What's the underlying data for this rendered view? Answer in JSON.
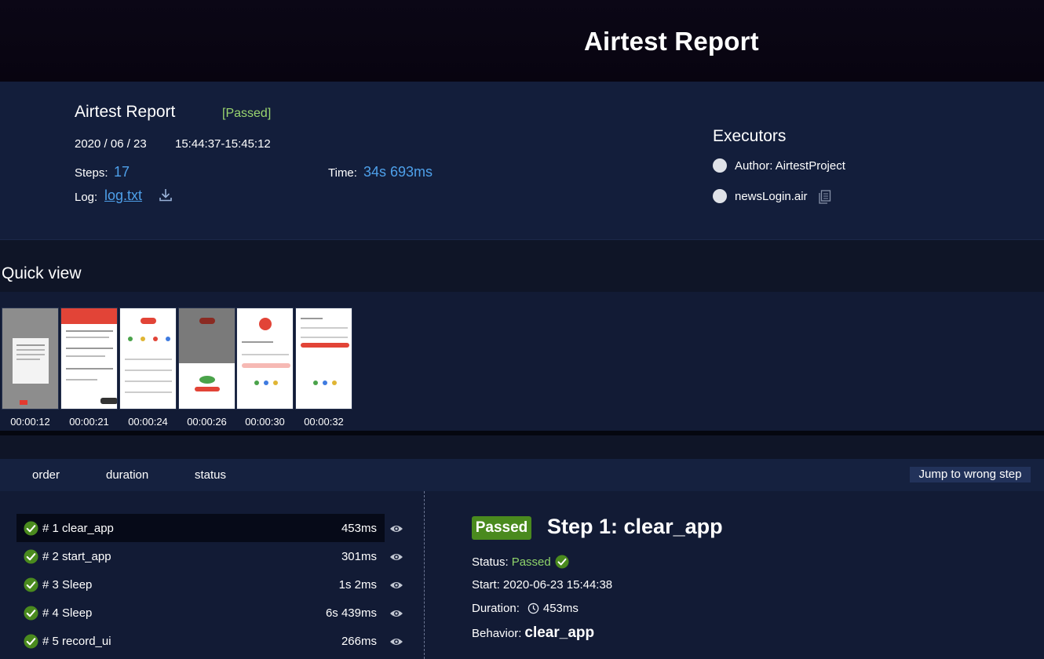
{
  "header": {
    "title": "Airtest Report"
  },
  "summary": {
    "title": "Airtest Report",
    "status": "[Passed]",
    "date": "2020 / 06 / 23",
    "time_range": "15:44:37-15:45:12",
    "steps_label": "Steps:",
    "steps_value": "17",
    "time_label": "Time:",
    "time_value": "34s 693ms",
    "log_label": "Log:",
    "log_link": "log.txt",
    "icons": {
      "status": "check-circle-icon",
      "download": "download-icon"
    }
  },
  "executors": {
    "title": "Executors",
    "items": [
      {
        "label": "Author: AirtestProject"
      },
      {
        "label": "newsLogin.air"
      }
    ],
    "copy_icon": "copy-icon"
  },
  "quick_view": {
    "title": "Quick view",
    "thumbnails": [
      {
        "time": "00:00:12"
      },
      {
        "time": "00:00:21"
      },
      {
        "time": "00:00:24"
      },
      {
        "time": "00:00:26"
      },
      {
        "time": "00:00:30"
      },
      {
        "time": "00:00:32"
      }
    ]
  },
  "steps_toolbar": {
    "sort_order": "order",
    "sort_duration": "duration",
    "sort_status": "status",
    "jump_button": "Jump to wrong step"
  },
  "steps": [
    {
      "label": "# 1 clear_app",
      "duration": "453ms",
      "active": true
    },
    {
      "label": "# 2 start_app",
      "duration": "301ms"
    },
    {
      "label": "# 3 Sleep",
      "duration": "1s 2ms"
    },
    {
      "label": "# 4 Sleep",
      "duration": "6s 439ms"
    },
    {
      "label": "# 5 record_ui",
      "duration": "266ms"
    }
  ],
  "detail": {
    "badge": "Passed",
    "title": "Step 1: clear_app",
    "status_label": "Status:",
    "status_value": "Passed",
    "start_label": "Start:",
    "start_value": "2020-06-23 15:44:38",
    "duration_label": "Duration:",
    "duration_value": "453ms",
    "behavior_label": "Behavior:",
    "behavior_value": "clear_app"
  },
  "colors": {
    "background": "#0e1423",
    "panel": "#131e3b",
    "accent_blue": "#4ea0ea",
    "pass_green": "#4a8a1e",
    "status_green": "#9ad56f"
  }
}
